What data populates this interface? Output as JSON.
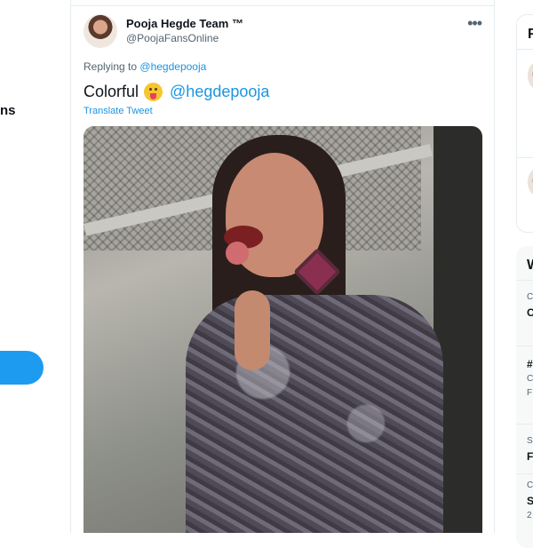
{
  "left_nav": {
    "label_fragment": "ns"
  },
  "tweet": {
    "display_name": "Pooja Hegde Team ™",
    "handle": "@PoojaFansOnline",
    "more_icon": "more-horizontal-icon",
    "replying_to_prefix": "Replying to",
    "replying_to_mention": "@hegdepooja",
    "text": "Colorful",
    "emoji": "face-with-tongue-emoji",
    "text_mention": "@hegdepooja",
    "translate_label": "Translate Tweet",
    "accent_color": "#1b95e0"
  },
  "right_sidebar": {
    "panel1_title_fragment": "F",
    "panel2_title_fragment": "W",
    "fragments": [
      "C",
      "C",
      "#",
      "C",
      "F",
      "S",
      "F",
      "C",
      "S",
      "2"
    ]
  }
}
